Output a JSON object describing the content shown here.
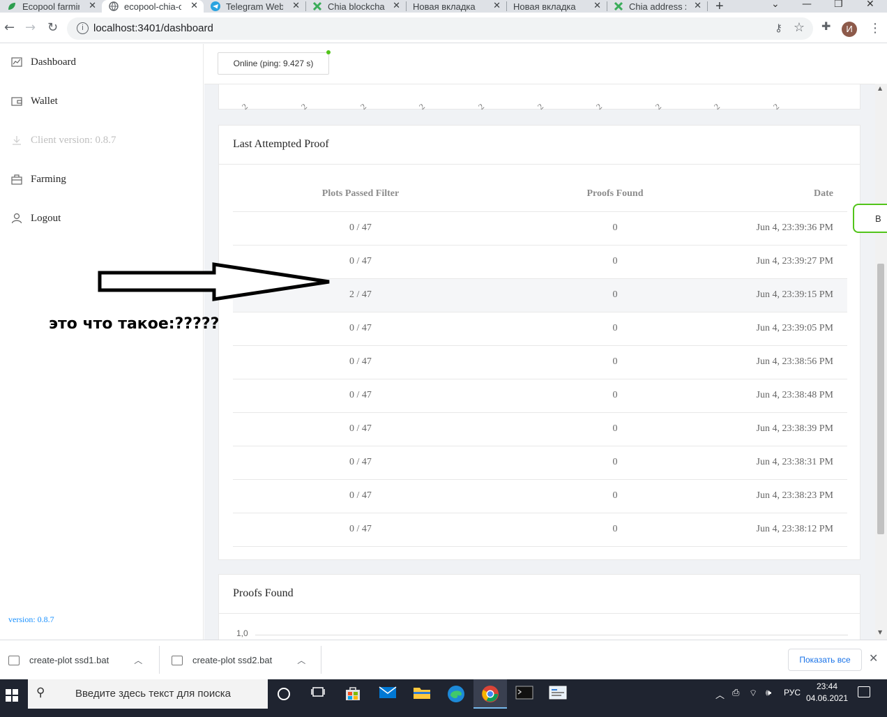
{
  "browser": {
    "tabs": [
      {
        "title": "Ecopool farmin",
        "icon": "leaf-icon"
      },
      {
        "title": "ecopool-chia-c",
        "icon": "globe-icon",
        "active": true
      },
      {
        "title": "Telegram Web",
        "icon": "telegram-icon"
      },
      {
        "title": "Chia blockchai",
        "icon": "chia-icon"
      },
      {
        "title": "Новая вкладка",
        "icon": ""
      },
      {
        "title": "Новая вкладка",
        "icon": ""
      },
      {
        "title": "Chia address x",
        "icon": "chia-icon"
      }
    ],
    "close_glyph": "✕",
    "new_tab_glyph": "+",
    "url": "localhost:3401/dashboard",
    "profile_initial": "И"
  },
  "sidebar": {
    "items": [
      {
        "label": "Dashboard",
        "icon": "chart-icon"
      },
      {
        "label": "Wallet",
        "icon": "wallet-icon"
      },
      {
        "label": "Client version: 0.8.7",
        "icon": "download-icon",
        "disabled": true
      },
      {
        "label": "Farming",
        "icon": "farming-icon"
      },
      {
        "label": "Logout",
        "icon": "user-icon"
      }
    ],
    "version": "version: 0.8.7"
  },
  "status": {
    "label": "Online (ping: 9.427 s)",
    "dot_color": "#52c41a"
  },
  "top_chart": {
    "tick_labels": [
      "2",
      "2",
      "2",
      "2",
      "2",
      "2",
      "2",
      "2",
      "2",
      "2"
    ]
  },
  "annotation": {
    "text": "это что такое:?????"
  },
  "last_proof": {
    "title": "Last Attempted Proof",
    "columns": [
      "Plots Passed Filter",
      "Proofs Found",
      "Date"
    ],
    "rows": [
      {
        "passed": "0 / 47",
        "found": "0",
        "date": "Jun 4, 23:39:36 PM"
      },
      {
        "passed": "0 / 47",
        "found": "0",
        "date": "Jun 4, 23:39:27 PM"
      },
      {
        "passed": "2 / 47",
        "found": "0",
        "date": "Jun 4, 23:39:15 PM",
        "highlighted": true
      },
      {
        "passed": "0 / 47",
        "found": "0",
        "date": "Jun 4, 23:39:05 PM"
      },
      {
        "passed": "0 / 47",
        "found": "0",
        "date": "Jun 4, 23:38:56 PM"
      },
      {
        "passed": "0 / 47",
        "found": "0",
        "date": "Jun 4, 23:38:48 PM"
      },
      {
        "passed": "0 / 47",
        "found": "0",
        "date": "Jun 4, 23:38:39 PM"
      },
      {
        "passed": "0 / 47",
        "found": "0",
        "date": "Jun 4, 23:38:31 PM"
      },
      {
        "passed": "0 / 47",
        "found": "0",
        "date": "Jun 4, 23:38:23 PM"
      },
      {
        "passed": "0 / 47",
        "found": "0",
        "date": "Jun 4, 23:38:12 PM"
      }
    ]
  },
  "proofs_found": {
    "title": "Proofs Found",
    "y_tick": "1,0"
  },
  "floating_button": {
    "label": "В"
  },
  "downloads": {
    "items": [
      {
        "name": "create-plot ssd1.bat"
      },
      {
        "name": "create-plot ssd2.bat"
      }
    ],
    "show_all": "Показать все"
  },
  "taskbar": {
    "search_placeholder": "Введите здесь текст для поиска",
    "lang": "РУС",
    "time": "23:44",
    "date": "04.06.2021",
    "accent": "#76b9ed"
  }
}
